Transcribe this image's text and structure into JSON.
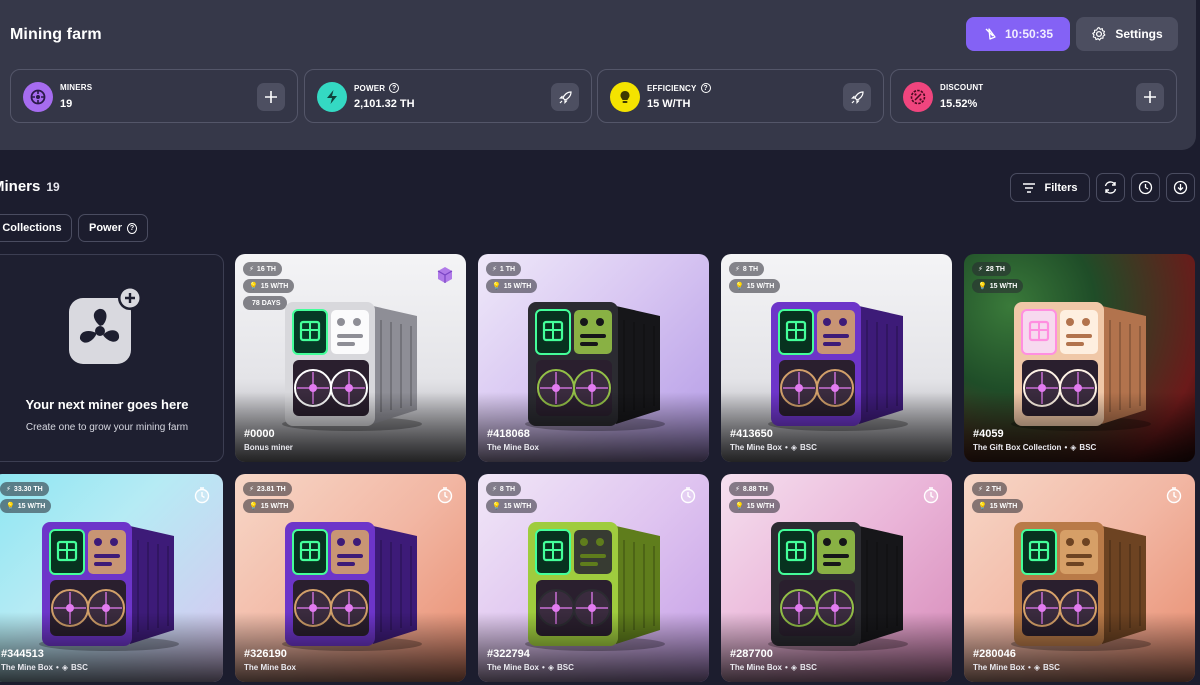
{
  "header": {
    "title": "Mining farm",
    "timer": "10:50:35",
    "settings_label": "Settings"
  },
  "stats": [
    {
      "label": "MINERS",
      "value": "19",
      "icon": "miner-icon",
      "color": "#a66cf0",
      "has_help": false,
      "action": "plus-icon"
    },
    {
      "label": "POWER",
      "value": "2,101.32 TH",
      "icon": "bolt-icon",
      "color": "#34d9c3",
      "has_help": true,
      "action": "rocket-icon"
    },
    {
      "label": "EFFICIENCY",
      "value": "15 W/TH",
      "icon": "bulb-icon",
      "color": "#f4e300",
      "has_help": true,
      "action": "rocket-icon"
    },
    {
      "label": "DISCOUNT",
      "value": "15.52%",
      "icon": "percent-icon",
      "color": "#f0457e",
      "has_help": false,
      "action": "plus-icon"
    }
  ],
  "miners_section": {
    "title": "Miners",
    "count": "19",
    "filters_label": "Filters",
    "chips": [
      "Collections",
      "Power"
    ]
  },
  "placeholder": {
    "title": "Your next miner goes here",
    "subtitle": "Create one to grow your mining farm"
  },
  "cards": [
    {
      "id": "#0000",
      "name": "Bonus miner",
      "chain": "",
      "badges": [
        "16 TH",
        "15 W/TH",
        "78 DAYS"
      ],
      "bg": "white",
      "box": "silver"
    },
    {
      "id": "#418068",
      "name": "The Mine Box",
      "chain": "",
      "badges": [
        "1 TH",
        "15 W/TH"
      ],
      "bg": "lavender",
      "box": "black"
    },
    {
      "id": "#413650",
      "name": "The Mine Box",
      "chain": "BSC",
      "badges": [
        "8 TH",
        "15 W/TH"
      ],
      "bg": "white",
      "box": "purple"
    },
    {
      "id": "#4059",
      "name": "The Gift Box Collection",
      "chain": "BSC",
      "badges": [
        "28 TH",
        "15 W/TH"
      ],
      "bg": "christmas",
      "box": "gingerbread"
    },
    {
      "id": "#344513",
      "name": "The Mine Box",
      "chain": "BSC",
      "badges": [
        "33.30 TH",
        "15 W/TH"
      ],
      "bg": "cyan",
      "box": "purple"
    },
    {
      "id": "#326190",
      "name": "The Mine Box",
      "chain": "",
      "badges": [
        "23.81 TH",
        "15 W/TH"
      ],
      "bg": "peach",
      "box": "purple"
    },
    {
      "id": "#322794",
      "name": "The Mine Box",
      "chain": "BSC",
      "badges": [
        "8 TH",
        "15 W/TH"
      ],
      "bg": "lilac",
      "box": "green"
    },
    {
      "id": "#287700",
      "name": "The Mine Box",
      "chain": "BSC",
      "badges": [
        "8.88 TH",
        "15 W/TH"
      ],
      "bg": "pink",
      "box": "black"
    },
    {
      "id": "#280046",
      "name": "The Mine Box",
      "chain": "BSC",
      "badges": [
        "2 TH",
        "15 W/TH"
      ],
      "bg": "peach",
      "box": "wood"
    }
  ],
  "colors": {
    "accent": "#8462f5",
    "panel": "#363849",
    "background": "#1c1d2e"
  }
}
